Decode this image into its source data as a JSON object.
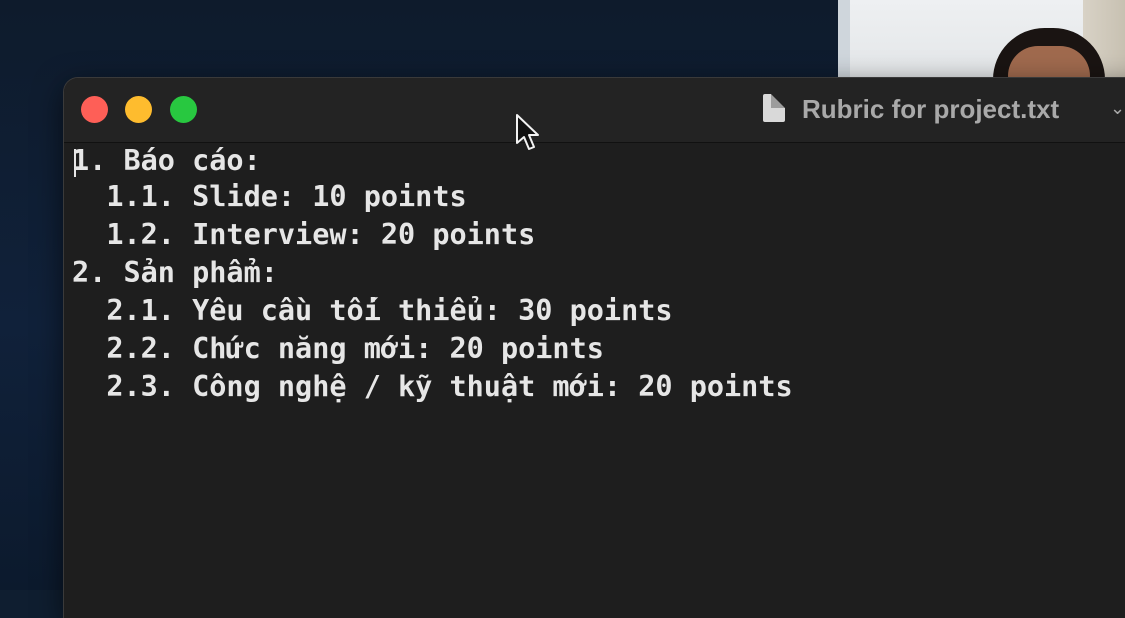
{
  "window": {
    "title": "Rubric for project.txt",
    "chevron": "⌄",
    "icon": "document-icon"
  },
  "editor": {
    "lines": [
      "1. Báo cáo:",
      "  1.1. Slide: 10 points",
      "  1.2. Interview: 20 points",
      "2. Sản phẩm:",
      "  2.1. Yêu cầu tối thiểu: 30 points",
      "  2.2. Chức năng mới: 20 points",
      "  2.3. Công nghệ / kỹ thuật mới: 20 points"
    ]
  },
  "colors": {
    "close": "#fe5f57",
    "minimize": "#febc2e",
    "zoom": "#28c840",
    "editor_bg": "#1e1e1e",
    "text": "#e6e6e6"
  }
}
